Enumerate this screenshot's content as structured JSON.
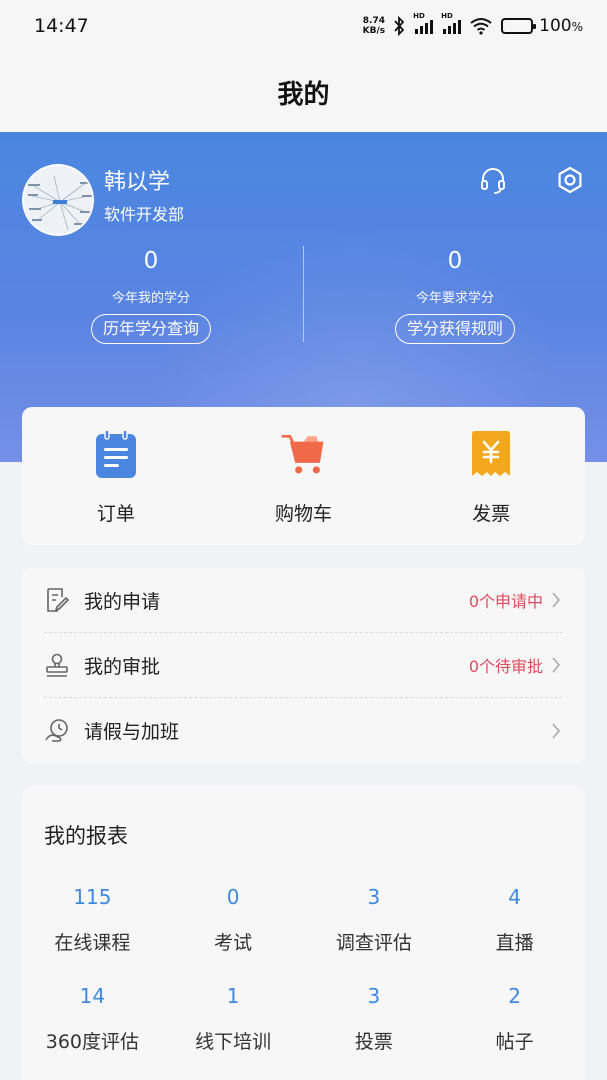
{
  "status_bar": {
    "time": "14:47",
    "net_speed_value": "8.74",
    "net_speed_unit": "KB/s",
    "hd_label": "HD",
    "battery": "100",
    "battery_unit": "%"
  },
  "header": {
    "title": "我的"
  },
  "profile": {
    "name": "韩以学",
    "department": "软件开发部",
    "icons": {
      "avatar": "avatar",
      "support": "headset-icon",
      "settings": "settings-icon"
    }
  },
  "credits": {
    "my_value": "0",
    "my_label": "今年我的学分",
    "my_button": "历年学分查询",
    "required_value": "0",
    "required_label": "今年要求学分",
    "required_button": "学分获得规则"
  },
  "quick_actions": [
    {
      "label": "订单",
      "icon": "order-icon",
      "color": "#4a86e0"
    },
    {
      "label": "购物车",
      "icon": "cart-icon",
      "color": "#f06a4a"
    },
    {
      "label": "发票",
      "icon": "invoice-icon",
      "color": "#f2a81d"
    }
  ],
  "menu": [
    {
      "label": "我的申请",
      "status": "0个申请中",
      "icon": "application-icon"
    },
    {
      "label": "我的审批",
      "status": "0个待审批",
      "icon": "approval-stamp-icon"
    },
    {
      "label": "请假与加班",
      "status": "",
      "icon": "leave-overtime-icon"
    }
  ],
  "reports": {
    "title": "我的报表",
    "items": [
      {
        "value": "115",
        "label": "在线课程"
      },
      {
        "value": "0",
        "label": "考试"
      },
      {
        "value": "3",
        "label": "调查评估"
      },
      {
        "value": "4",
        "label": "直播"
      },
      {
        "value": "14",
        "label": "360度评估"
      },
      {
        "value": "1",
        "label": "线下培训"
      },
      {
        "value": "3",
        "label": "投票"
      },
      {
        "value": "2",
        "label": "帖子"
      }
    ]
  },
  "colors": {
    "accent_blue": "#3e88e0",
    "status_red": "#e04a5a",
    "hero_gradient_top": "#4a86e0",
    "hero_gradient_bottom": "#7590e6"
  }
}
